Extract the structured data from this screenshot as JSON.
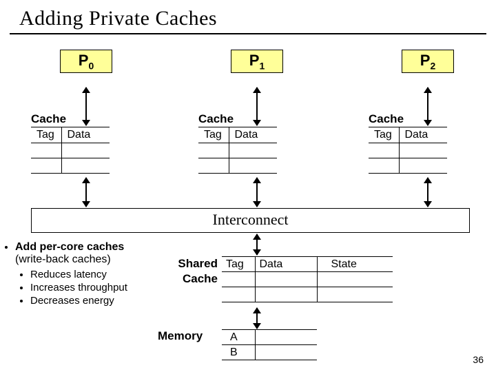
{
  "title": "Adding Private Caches",
  "processors": {
    "p0": "P",
    "p0_sub": "0",
    "p1": "P",
    "p1_sub": "1",
    "p2": "P",
    "p2_sub": "2"
  },
  "cache": {
    "label": "Cache",
    "tag": "Tag",
    "data": "Data"
  },
  "interconnect": "Interconnect",
  "bullets": {
    "b1": "Add per-core caches",
    "b2": "(write-back caches)",
    "s1": "Reduces latency",
    "s2": "Increases throughput",
    "s3": "Decreases energy"
  },
  "shared": {
    "label1": "Shared",
    "label2": "Cache",
    "tag": "Tag",
    "data": "Data",
    "state": "State"
  },
  "memory": {
    "label": "Memory",
    "rowA": "A",
    "rowB": "B"
  },
  "slide_number": "36"
}
